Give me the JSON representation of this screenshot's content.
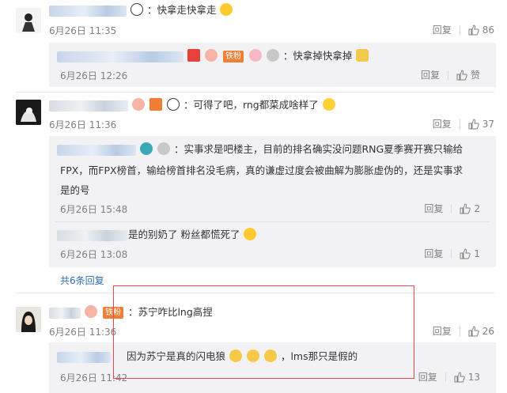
{
  "comments": [
    {
      "text": "：快拿走快拿走",
      "time": "6月26日 11:35",
      "reply": "回复",
      "likes": "86"
    },
    {
      "text": "：快拿掉快拿掉",
      "time": "6月26日 12:26",
      "reply": "回复",
      "likes": "赞",
      "badge": "铁粉"
    },
    {
      "text": "：可得了吧，rng都菜成啥样了",
      "time": "6月26日 11:36",
      "reply": "回复",
      "likes": "37"
    },
    {
      "text_line1": "：实事求是吧楼主，目前的排名确实没问题RNG夏季赛开赛只输给",
      "text_line2": "FPX，而FPX榜首，输给榜首排名没毛病，真的谦虚过度会被曲解为膨胀虚伪的，还是实事求",
      "text_line3": "是的号",
      "time": "6月26日 15:48",
      "reply": "回复",
      "likes": "2"
    },
    {
      "text": "是的别奶了 粉丝都慌死了",
      "time": "6月26日 13:08",
      "reply": "回复",
      "likes": "1"
    },
    {
      "more": "共6条回复"
    },
    {
      "text": "：苏宁咋比lng高捏",
      "time": "6月26日 11:36",
      "reply": "回复",
      "likes": "26",
      "badge": "铁粉"
    },
    {
      "text_prefix": "因为苏宁是真的闪电狼",
      "text_suffix": "，lms那只是假的",
      "time": "6月26日 11:42",
      "reply": "回复",
      "likes": "13"
    }
  ],
  "icons": {
    "like": "thumbs-up-icon",
    "panda": "panda-emoji-icon",
    "laugh": "laugh-emoji-icon",
    "cat": "cat-emoji-icon"
  },
  "colors": {
    "link": "#2d6bb0",
    "badge": "#ef7f36",
    "highlight": "#e8494f"
  }
}
